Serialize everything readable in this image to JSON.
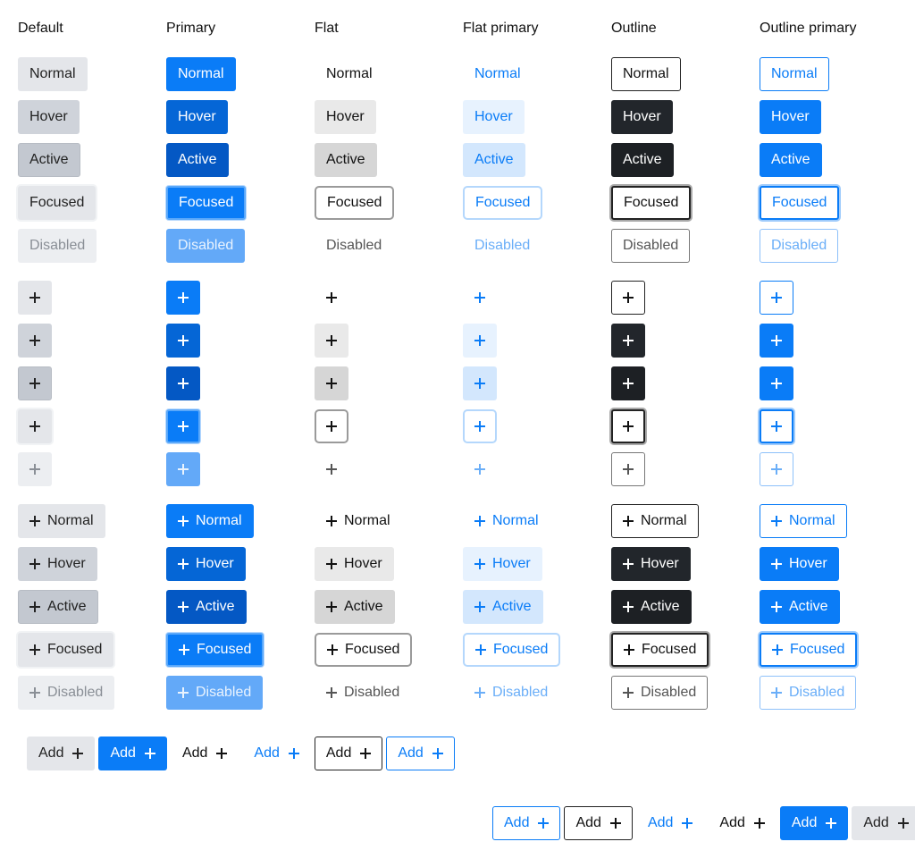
{
  "columns": [
    {
      "key": "default",
      "label": "Default"
    },
    {
      "key": "primary",
      "label": "Primary"
    },
    {
      "key": "flat",
      "label": "Flat"
    },
    {
      "key": "flatprimary",
      "label": "Flat primary"
    },
    {
      "key": "outline",
      "label": "Outline"
    },
    {
      "key": "outlineprimary",
      "label": "Outline primary"
    }
  ],
  "states": [
    {
      "key": "normal",
      "label": "Normal"
    },
    {
      "key": "hover",
      "label": "Hover"
    },
    {
      "key": "active",
      "label": "Active"
    },
    {
      "key": "focused",
      "label": "Focused"
    },
    {
      "key": "disabled",
      "label": "Disabled"
    }
  ],
  "icon": "plus-icon",
  "strip_top": {
    "label": "Add",
    "variants": [
      "default",
      "primary",
      "flat",
      "flatprimary",
      "outline",
      "outlineprimary"
    ]
  },
  "strip_bottom": {
    "label": "Add",
    "variants": [
      "outlineprimary",
      "outline",
      "flatprimary",
      "flat",
      "primary",
      "default"
    ]
  }
}
